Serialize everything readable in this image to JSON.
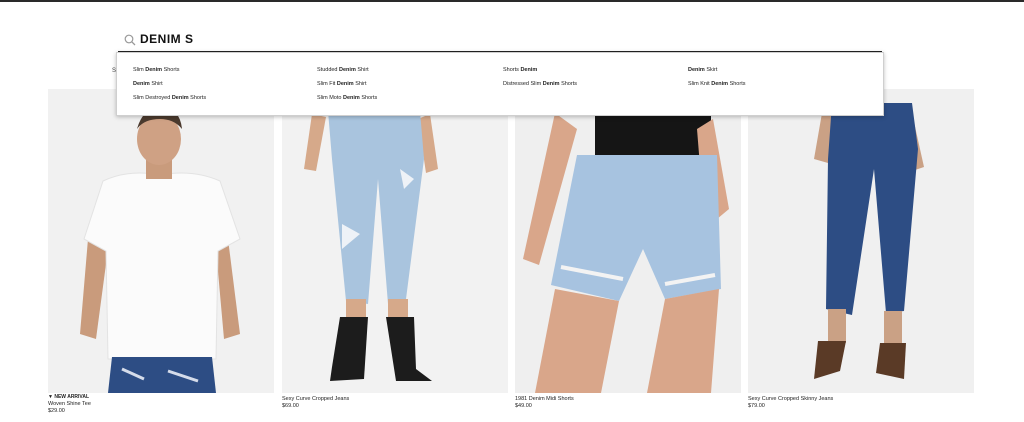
{
  "search": {
    "query": "DENIM S",
    "placeholder": "Search"
  },
  "suggestions": [
    {
      "pre": "Slim ",
      "bold": "Denim",
      "post": " Shorts"
    },
    {
      "pre": "Studded ",
      "bold": "Denim",
      "post": " Shirt"
    },
    {
      "pre": "Shorts ",
      "bold": "Denim",
      "post": ""
    },
    {
      "pre": "",
      "bold": "Denim",
      "post": " Skirt"
    },
    {
      "pre": "",
      "bold": "Denim",
      "post": " Shirt"
    },
    {
      "pre": "Slim Fit ",
      "bold": "Denim",
      "post": " Shirt"
    },
    {
      "pre": "Distressed Slim ",
      "bold": "Denim",
      "post": " Shorts"
    },
    {
      "pre": "Slim Knit ",
      "bold": "Denim",
      "post": " Shorts"
    },
    {
      "pre": "Slim Destroyed ",
      "bold": "Denim",
      "post": " Shorts"
    },
    {
      "pre": "Slim Moto ",
      "bold": "Denim",
      "post": " Shorts"
    }
  ],
  "edge_fragment": "S",
  "products": [
    {
      "badge": "▼ NEW ARRIVAL",
      "name": "Woven Shine Tee",
      "price": "$29.00",
      "icon": "man-white-tee-image"
    },
    {
      "badge": "",
      "name": "Sexy Curve Cropped Jeans",
      "price": "$69.00",
      "icon": "light-wash-cropped-jeans-image"
    },
    {
      "badge": "",
      "name": "1981 Denim Midi Shorts",
      "price": "$49.00",
      "icon": "denim-shorts-image"
    },
    {
      "badge": "",
      "name": "Sexy Curve Cropped Skinny Jeans",
      "price": "$79.00",
      "icon": "dark-wash-skinny-jeans-image"
    }
  ],
  "colors": {
    "light_denim": "#a9c4de",
    "dark_denim": "#2d4d84",
    "photo_bg": "#f1f1f1"
  }
}
